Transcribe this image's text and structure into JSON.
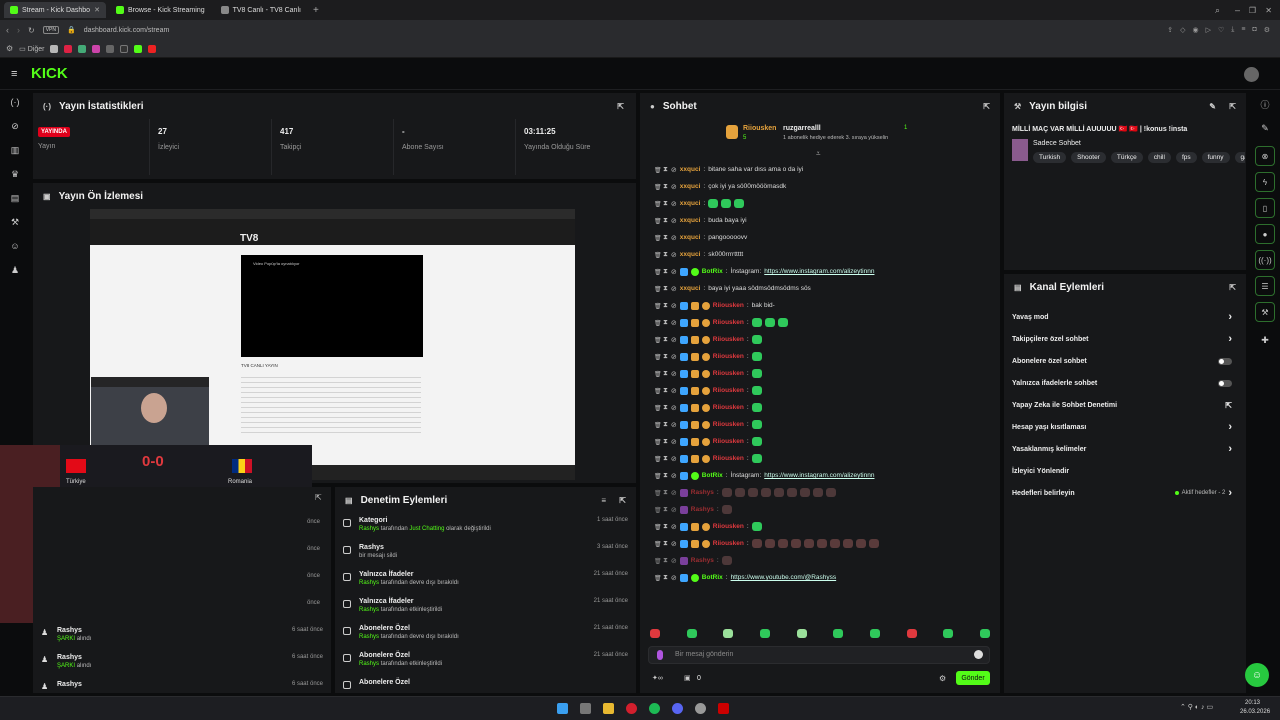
{
  "browser": {
    "tabs": [
      {
        "label": "Stream - Kick Dashbo",
        "color": "#53fc18"
      },
      {
        "label": "Browse - Kick Streaming",
        "color": "#53fc18"
      },
      {
        "label": "TV8 Canlı - TV8 Canlı",
        "color": "#888888"
      }
    ],
    "url": "dashboard.kick.com/stream",
    "vpn": "VPN",
    "bookmarks_folder": "Diğer"
  },
  "app": {
    "logo": "KICK",
    "accent": "#53fc18"
  },
  "stats": {
    "title": "Yayın İstatistikleri",
    "live_badge": "YAYINDA",
    "live_label": "Yayın",
    "viewers": {
      "value": "27",
      "label": "İzleyici"
    },
    "followers": {
      "value": "417",
      "label": "Takipçi"
    },
    "subs": {
      "value": "-",
      "label": "Abone Sayısı"
    },
    "uptime": {
      "value": "03:11:25",
      "label": "Yayında Olduğu Süre"
    }
  },
  "preview": {
    "title": "Yayın Ön İzlemesi",
    "tv8_logo": "TV8",
    "video_placeholder": "Video Popüp'ta oynatılıyor",
    "live_text": "TV8 CANLI YAYIN",
    "score": "0-0",
    "team_left": "Türkiye",
    "team_right": "Romania"
  },
  "moderation": {
    "title": "Denetim Eylemleri",
    "rows": [
      {
        "title": "Kategori",
        "user": "Rashys",
        "rest": "tarafından",
        "highlight": "Just Chatting",
        "after": "olarak değiştirildi",
        "time": "1 saat önce"
      },
      {
        "title": "Rashys",
        "user": "",
        "rest": "bir mesajı sildi",
        "highlight": "",
        "after": "",
        "time": "3 saat önce"
      },
      {
        "title": "Yalnızca İfadeler",
        "user": "Rashys",
        "rest": "tarafından devre dışı bırakıldı",
        "highlight": "",
        "after": "",
        "time": "21 saat önce"
      },
      {
        "title": "Yalnızca İfadeler",
        "user": "Rashys",
        "rest": "tarafından etkinleştirildi",
        "highlight": "",
        "after": "",
        "time": "21 saat önce"
      },
      {
        "title": "Abonelere Özel",
        "user": "Rashys",
        "rest": "tarafından devre dışı bırakıldı",
        "highlight": "",
        "after": "",
        "time": "21 saat önce"
      },
      {
        "title": "Abonelere Özel",
        "user": "Rashys",
        "rest": "tarafından etkinleştirildi",
        "highlight": "",
        "after": "",
        "time": "21 saat önce"
      },
      {
        "title": "Abonelere Özel",
        "user": "",
        "rest": "",
        "highlight": "",
        "after": "",
        "time": ""
      }
    ],
    "left_rows": [
      {
        "name": "Rashys",
        "sub": "ŞARKI",
        "subrest": "alındı",
        "time": "6 saat önce"
      },
      {
        "name": "Rashys",
        "sub": "ŞARKI",
        "subrest": "alındı",
        "time": "6 saat önce"
      },
      {
        "name": "Rashys",
        "sub": "",
        "subrest": "",
        "time": "6 saat önce"
      }
    ],
    "left_times": [
      "önce",
      "önce",
      "önce",
      "önce"
    ]
  },
  "chat": {
    "title": "Sohbet",
    "pinned": {
      "gifter": "Riiousken",
      "gifter_count": "5",
      "recipient": "ruzgarrealll",
      "recipient_count": "1",
      "text": "1 abonelik hediye ederek 3. sıraya yükselin"
    },
    "messages": [
      {
        "user": "xxquci",
        "color": "orange",
        "text": "bitane saha var dıss ama o da iyi",
        "link": "",
        "badges": 0
      },
      {
        "user": "xxquci",
        "color": "orange",
        "text": "çok iyi ya sö00mööömasdk",
        "link": "",
        "badges": 0
      },
      {
        "user": "xxquci",
        "color": "orange",
        "text": "",
        "link": "",
        "badges": 0,
        "emotes": 3
      },
      {
        "user": "xxquci",
        "color": "orange",
        "text": "buda baya iyi",
        "link": "",
        "badges": 0
      },
      {
        "user": "xxquci",
        "color": "orange",
        "text": "pangooooovv",
        "link": "",
        "badges": 0
      },
      {
        "user": "xxquci",
        "color": "orange",
        "text": "sk000rrrrttttt",
        "link": "",
        "badges": 0
      },
      {
        "user": "BotRix",
        "color": "green",
        "text": "İnstagram:",
        "link": "https://www.instagram.com/alizeytinnn",
        "badges": 2
      },
      {
        "user": "xxquci",
        "color": "orange",
        "text": "baya iyi yaaa södmsödmsödms sös",
        "link": "",
        "badges": 0
      },
      {
        "user": "Riiousken",
        "color": "red",
        "text": "bak bid-",
        "link": "",
        "badges": 3
      },
      {
        "user": "Riiousken",
        "color": "red",
        "text": "",
        "link": "",
        "badges": 3,
        "emotes": 3
      },
      {
        "user": "Riiousken",
        "color": "red",
        "text": "",
        "link": "",
        "badges": 3,
        "emotes": 1
      },
      {
        "user": "Riiousken",
        "color": "red",
        "text": "",
        "link": "",
        "badges": 3,
        "emotes": 1
      },
      {
        "user": "Riiousken",
        "color": "red",
        "text": "",
        "link": "",
        "badges": 3,
        "emotes": 1
      },
      {
        "user": "Riiousken",
        "color": "red",
        "text": "",
        "link": "",
        "badges": 3,
        "emotes": 1
      },
      {
        "user": "Riiousken",
        "color": "red",
        "text": "",
        "link": "",
        "badges": 3,
        "emotes": 1
      },
      {
        "user": "Riiousken",
        "color": "red",
        "text": "",
        "link": "",
        "badges": 3,
        "emotes": 1
      },
      {
        "user": "Riiousken",
        "color": "red",
        "text": "",
        "link": "",
        "badges": 3,
        "emotes": 1
      },
      {
        "user": "Riiousken",
        "color": "red",
        "text": "",
        "link": "",
        "badges": 3,
        "emotes": 1
      },
      {
        "user": "BotRix",
        "color": "green",
        "text": "İnstagram:",
        "link": "https://www.instagram.com/alizeytinnn",
        "badges": 2
      },
      {
        "user": "Rashys",
        "color": "red",
        "text": "",
        "link": "",
        "badges": 1,
        "emotes": 9,
        "dim": true
      },
      {
        "user": "Rashys",
        "color": "red",
        "text": "",
        "link": "",
        "badges": 1,
        "emotes": 1,
        "dim": true
      },
      {
        "user": "Riiousken",
        "color": "red",
        "text": "",
        "link": "",
        "badges": 3,
        "emotes": 1
      },
      {
        "user": "Riiousken",
        "color": "red",
        "text": "",
        "link": "",
        "badges": 3,
        "emotes": 10
      },
      {
        "user": "Rashys",
        "color": "red",
        "text": "",
        "link": "",
        "badges": 1,
        "emotes": 1,
        "dim": true
      },
      {
        "user": "BotRix",
        "color": "green",
        "text": "",
        "link": "https://www.youtube.com/@Rashyss",
        "badges": 2
      }
    ],
    "input_placeholder": "Bir mesaj gönderin",
    "points": "0",
    "send_label": "Gönder"
  },
  "info": {
    "title": "Yayın bilgisi",
    "stream_title": "MİLLİ MAÇ VAR MİLLİ AUUUUU 🇹🇷 🇹🇷 | !konus !insta",
    "category": "Sadece Sohbet",
    "tags": [
      "Turkish",
      "Shooter",
      "Türkçe",
      "chill",
      "fps",
      "funny",
      "gam"
    ]
  },
  "actions": {
    "title": "Kanal Eylemleri",
    "items": [
      {
        "label": "Yavaş mod",
        "control": "chevron"
      },
      {
        "label": "Takipçilere özel sohbet",
        "control": "chevron"
      },
      {
        "label": "Abonelere özel sohbet",
        "control": "toggle"
      },
      {
        "label": "Yalnızca ifadelerle sohbet",
        "control": "toggle"
      },
      {
        "label": "Yapay Zeka ile Sohbet Denetimi",
        "control": "external"
      },
      {
        "label": "Hesap yaşı kısıtlaması",
        "control": "chevron"
      },
      {
        "label": "Yasaklanmış kelimeler",
        "control": "chevron"
      },
      {
        "label": "İzleyici Yönlendir",
        "control": "none"
      },
      {
        "label": "Hedefleri belirleyin",
        "control": "goals"
      }
    ],
    "goals_status": "Aktif hedefler - 2"
  },
  "taskbar": {
    "time": "20:13",
    "date": "26.03.2026"
  }
}
